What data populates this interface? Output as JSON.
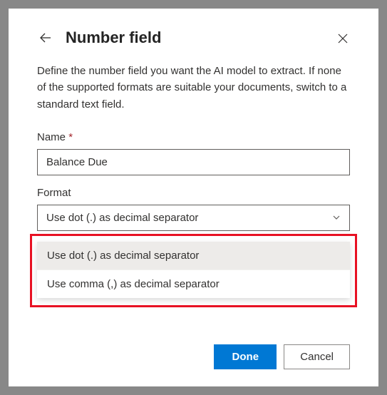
{
  "header": {
    "title": "Number field"
  },
  "description": "Define the number field you want the AI model to extract. If none of the supported formats are suitable your documents, switch to a standard text field.",
  "fields": {
    "name": {
      "label": "Name",
      "required_mark": "*",
      "value": "Balance Due"
    },
    "format": {
      "label": "Format",
      "selected": "Use dot (.) as decimal separator",
      "options": [
        "Use dot (.) as decimal separator",
        "Use comma (,) as decimal separator"
      ]
    }
  },
  "buttons": {
    "done": "Done",
    "cancel": "Cancel"
  }
}
